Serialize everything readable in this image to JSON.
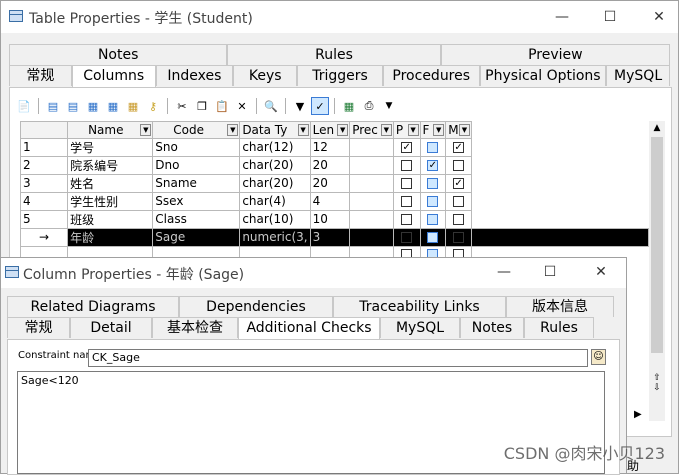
{
  "main_window": {
    "title": "Table Properties - 学生 (Student)",
    "tabs_row1": [
      "Notes",
      "Rules",
      "Preview"
    ],
    "tabs_row2": [
      "常规",
      "Columns",
      "Indexes",
      "Keys",
      "Triggers",
      "Procedures",
      "Physical Options",
      "MySQL"
    ],
    "selected_tab": "Columns",
    "columns": [
      "Name",
      "Code",
      "Data Ty",
      "Len",
      "Prec",
      "P",
      "F",
      "M"
    ],
    "rows": [
      {
        "num": "1",
        "name": "学号",
        "code": "Sno",
        "type": "char(12)",
        "len": "12",
        "p": true,
        "f": false,
        "m": true
      },
      {
        "num": "2",
        "name": "院系编号",
        "code": "Dno",
        "type": "char(20)",
        "len": "20",
        "p": false,
        "f": true,
        "m": false
      },
      {
        "num": "3",
        "name": "姓名",
        "code": "Sname",
        "type": "char(20)",
        "len": "20",
        "p": false,
        "f": false,
        "m": true
      },
      {
        "num": "4",
        "name": "学生性别",
        "code": "Ssex",
        "type": "char(4)",
        "len": "4",
        "p": false,
        "f": false,
        "m": false
      },
      {
        "num": "5",
        "name": "班级",
        "code": "Class",
        "type": "char(10)",
        "len": "10",
        "p": false,
        "f": false,
        "m": false
      },
      {
        "num": "→",
        "name": "年龄",
        "code": "Sage",
        "type": "numeric(3,",
        "len": "3",
        "p": false,
        "f": false,
        "m": false
      }
    ]
  },
  "column_window": {
    "title": "Column Properties - 年龄 (Sage)",
    "tabs_row1": [
      "Related Diagrams",
      "Dependencies",
      "Traceability Links",
      "版本信息"
    ],
    "tabs_row2": [
      "常规",
      "Detail",
      "基本检查",
      "Additional Checks",
      "MySQL",
      "Notes",
      "Rules"
    ],
    "selected_tab": "Additional Checks",
    "constraint_label": "Constraint name:",
    "constraint_value": "CK_Sage",
    "expression": "Sage<120"
  },
  "bottom_right_text": "助",
  "watermark": "CSDN @肉宋小贝123"
}
